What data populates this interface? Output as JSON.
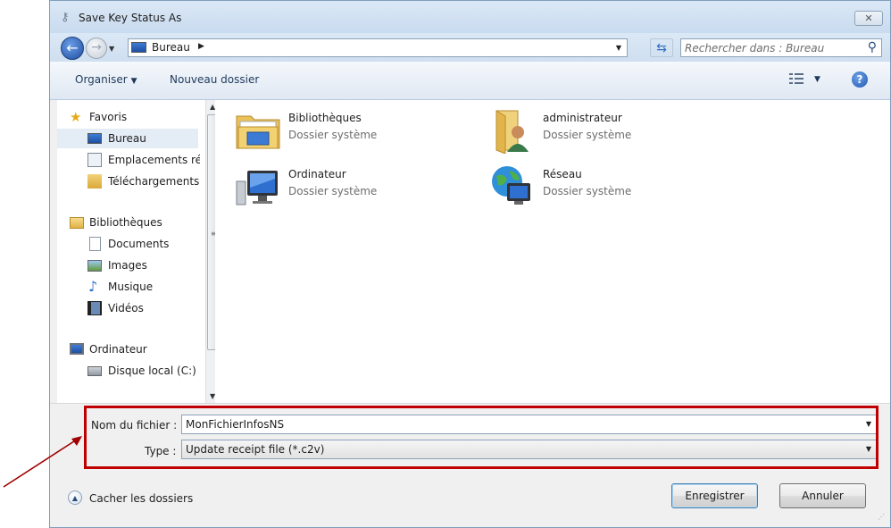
{
  "window": {
    "title": "Save Key Status As",
    "close_symbol": "✕"
  },
  "navigation": {
    "location": "Bureau",
    "search_placeholder": "Rechercher dans : Bureau"
  },
  "toolbar": {
    "organize": "Organiser",
    "new_folder": "Nouveau dossier"
  },
  "sidebar": {
    "favorites_header": "Favoris",
    "favorites": [
      {
        "label": "Bureau",
        "icon": "desktop-icon",
        "selected": true
      },
      {
        "label": "Emplacements ré",
        "icon": "recent-places-icon"
      },
      {
        "label": "Téléchargements",
        "icon": "downloads-icon"
      }
    ],
    "libraries_header": "Bibliothèques",
    "libraries": [
      {
        "label": "Documents",
        "icon": "documents-icon"
      },
      {
        "label": "Images",
        "icon": "pictures-icon"
      },
      {
        "label": "Musique",
        "icon": "music-icon"
      },
      {
        "label": "Vidéos",
        "icon": "videos-icon"
      }
    ],
    "computer_header": "Ordinateur",
    "drives": [
      {
        "label": "Disque local (C:)",
        "icon": "local-disk-icon"
      }
    ]
  },
  "files": [
    {
      "name": "Bibliothèques",
      "type": "Dossier système",
      "icon": "libraries-folder-icon"
    },
    {
      "name": "administrateur",
      "type": "Dossier système",
      "icon": "user-folder-icon"
    },
    {
      "name": "Ordinateur",
      "type": "Dossier système",
      "icon": "computer-icon"
    },
    {
      "name": "Réseau",
      "type": "Dossier système",
      "icon": "network-icon"
    }
  ],
  "form": {
    "filename_label": "Nom du fichier :",
    "filename_value": "MonFichierInfosNS",
    "type_label": "Type :",
    "type_value": "Update receipt file (*.c2v)"
  },
  "footer": {
    "hide_folders": "Cacher les dossiers",
    "save_button": "Enregistrer",
    "cancel_button": "Annuler"
  },
  "colors": {
    "highlight_border": "#c00000",
    "annotation_arrow": "#a00000",
    "accent": "#1f56b0"
  }
}
